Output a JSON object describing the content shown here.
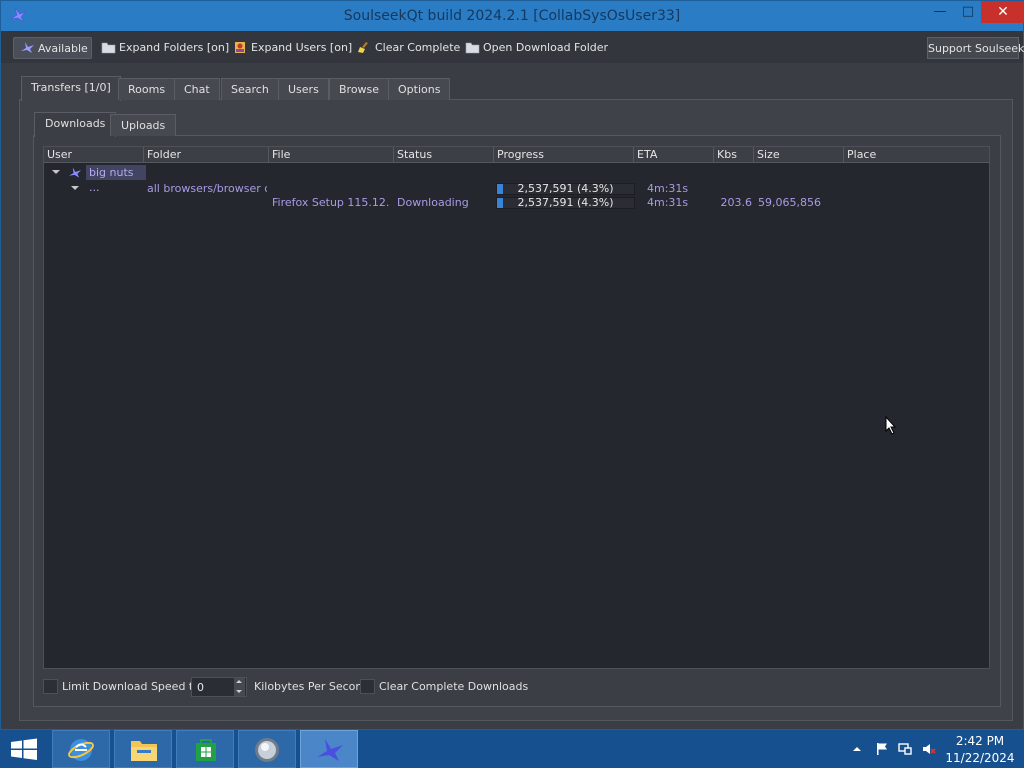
{
  "window": {
    "title": "SoulseekQt build 2024.2.1 [CollabSysOsUser33]",
    "minimize_glyph": "—",
    "maximize_glyph": "□",
    "close_glyph": "✕"
  },
  "toolbar": {
    "available": "Available",
    "expand_folders": "Expand Folders [on]",
    "expand_users": "Expand Users [on]",
    "clear_complete": "Clear Complete",
    "open_download_folder": "Open Download Folder",
    "support": "Support Soulseek!"
  },
  "main_tabs": [
    "Transfers [1/0]",
    "Rooms",
    "Chat",
    "Search",
    "Users",
    "Browse",
    "Options"
  ],
  "sub_tabs": [
    "Downloads",
    "Uploads"
  ],
  "columns": [
    "User",
    "Folder",
    "File",
    "Status",
    "Progress",
    "ETA",
    "Kbs",
    "Size",
    "Place"
  ],
  "rows": {
    "user": "big nuts ...",
    "folder": {
      "name": "all browsers/browser c...",
      "progress_text": "2,537,591 (4.3%)",
      "progress_fraction": 0.043,
      "eta": "4m:31s"
    },
    "file": {
      "name": "Firefox Setup 115.12. ...",
      "status": "Downloading",
      "progress_text": "2,537,591 (4.3%)",
      "progress_fraction": 0.043,
      "eta": "4m:31s",
      "kbs": "203.6",
      "size": "59,065,856"
    }
  },
  "bottom": {
    "limit_label": "Limit Download Speed to",
    "speed_value": "0",
    "unit_label": "Kilobytes Per Second",
    "clear_label": "Clear Complete Downloads"
  },
  "taskbar": {
    "time": "2:42 PM",
    "date": "11/22/2024"
  },
  "colors": {
    "titlebar": "#2a7cc4",
    "window_bg": "#3a3d44",
    "grid_bg": "#24272d",
    "row_text": "#a79be6",
    "progress_fill": "#3a84d8",
    "taskbar": "#16508f"
  },
  "icons": [
    "soulseek-bird-icon",
    "folder-icon",
    "users-icon",
    "broom-icon",
    "windows-start-icon",
    "ie-icon",
    "explorer-icon",
    "store-icon",
    "media-icon",
    "flag-icon",
    "network-icon",
    "volume-muted-icon"
  ]
}
